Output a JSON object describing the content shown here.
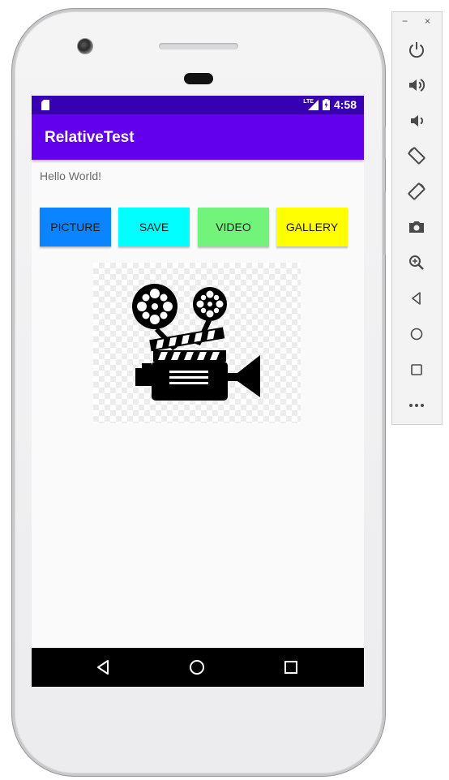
{
  "status_bar": {
    "network": "LTE",
    "time": "4:58"
  },
  "app": {
    "title": "RelativeTest"
  },
  "content": {
    "hello_text": "Hello World!",
    "buttons": [
      {
        "label": "PICTURE",
        "color": "#0a84ff"
      },
      {
        "label": "SAVE",
        "color": "#00ffff"
      },
      {
        "label": "VIDEO",
        "color": "#72f47a"
      },
      {
        "label": "GALLERY",
        "color": "#ffff00"
      }
    ],
    "image": {
      "icon": "movie-camera-clapperboard-icon"
    }
  },
  "nav_bar": {
    "items": [
      "back-icon",
      "home-icon",
      "recents-icon"
    ]
  },
  "emulator_toolbar": {
    "window_controls": [
      "−",
      "×"
    ],
    "items": [
      "power-icon",
      "volume-up-icon",
      "volume-down-icon",
      "rotate-left-icon",
      "rotate-right-icon",
      "camera-screenshot-icon",
      "zoom-icon",
      "back-icon",
      "home-icon",
      "overview-icon",
      "more-icon"
    ]
  },
  "colors": {
    "status_bar": "#3700b3",
    "app_bar": "#6200ee",
    "screen_bg": "#fafafa"
  }
}
